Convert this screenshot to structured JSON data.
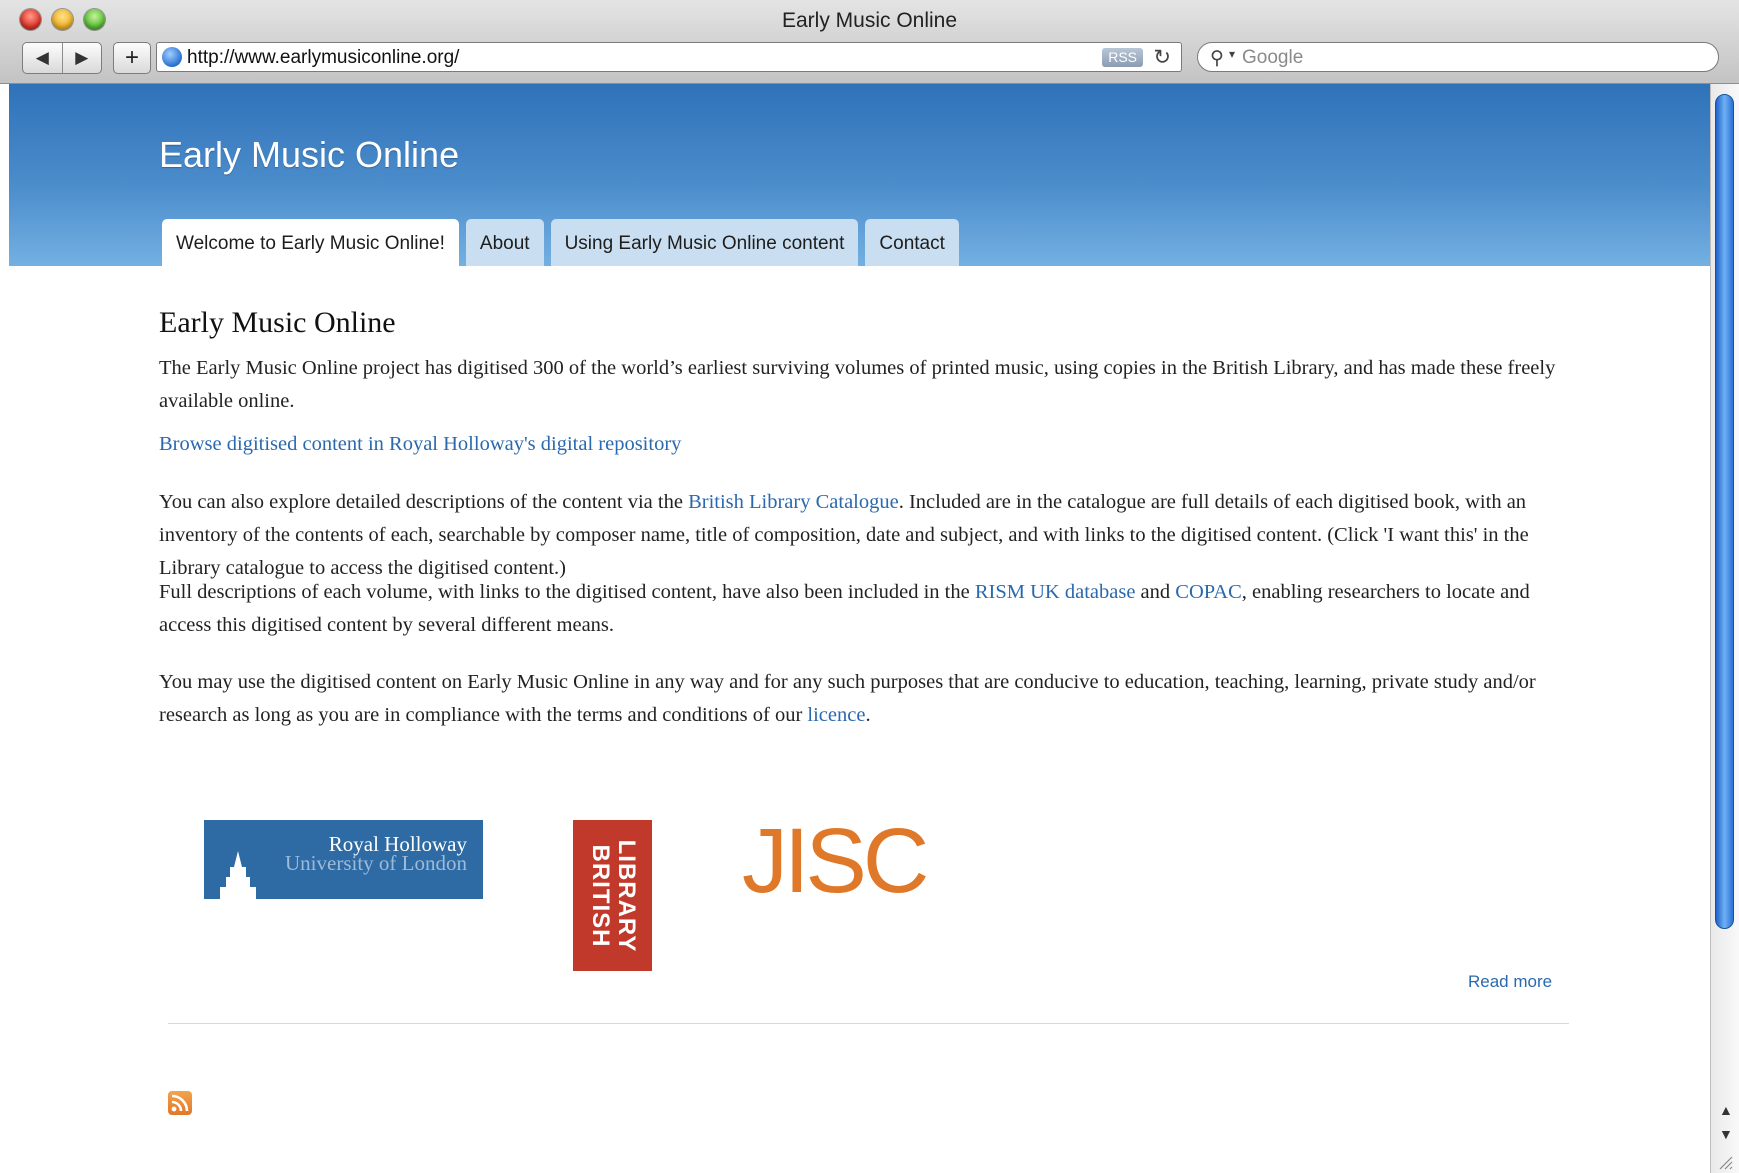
{
  "browser": {
    "window_title": "Early Music Online",
    "url": "http://www.earlymusiconline.org/",
    "rss_label": "RSS",
    "search_placeholder": "Google",
    "back_glyph": "◀",
    "forward_glyph": "▶",
    "add_glyph": "+",
    "reload_glyph": "↻"
  },
  "site": {
    "title": "Early Music Online",
    "tabs": [
      {
        "label": "Welcome to Early Music Online!",
        "active": true
      },
      {
        "label": "About",
        "active": false
      },
      {
        "label": "Using Early Music Online content",
        "active": false
      },
      {
        "label": "Contact",
        "active": false
      }
    ]
  },
  "content": {
    "heading": "Early Music Online",
    "p1": "The Early Music Online project has digitised 300 of the world’s earliest surviving volumes of printed music, using copies in the British Library, and has made these freely available online.",
    "browse_link": "Browse digitised content in Royal Holloway's digital repository",
    "p3_before": "You can also explore detailed descriptions of the content via the ",
    "p3_link": "British Library Catalogue",
    "p3_after": ". Included are in the catalogue are full details of each digitised book, with an inventory of the contents of each, searchable by composer name, title of composition, date and subject, and with links to the digitised content. (Click 'I want this' in the Library catalogue to access the digitised content.)",
    "p4_before": "Full descriptions of each volume, with links to the digitised content, have also been included in the ",
    "p4_link1": "RISM UK database",
    "p4_mid": " and ",
    "p4_link2": "COPAC",
    "p4_after": ", enabling researchers to locate and access this digitised content by several different means.",
    "p5_before": "You may use the digitised content on Early Music Online in any way and for any such purposes that are conducive to education, teaching, learning, private study and/or research as long as you are in compliance with the terms and conditions of our ",
    "p5_link": "licence",
    "p5_after": ".",
    "read_more": "Read more"
  },
  "logos": {
    "royal_holloway_name": "Royal Holloway",
    "royal_holloway_sub": "University of London",
    "british_library_line1": "BRITISH",
    "british_library_line2": "LIBRARY",
    "jisc": "JISC"
  },
  "colors": {
    "header_top": "#2f72b8",
    "header_bottom": "#73b0e2",
    "tab_bg": "#c9def0",
    "link": "#2a69ad",
    "rh_blue": "#2e6aa3",
    "bl_red": "#c0392b",
    "jisc_orange": "#e0782a"
  },
  "icons": [
    "back-arrow-icon",
    "forward-arrow-icon",
    "add-bookmark-icon",
    "globe-icon",
    "reload-icon",
    "search-icon",
    "rss-feed-icon",
    "close-window-icon",
    "minimize-window-icon",
    "zoom-window-icon"
  ]
}
